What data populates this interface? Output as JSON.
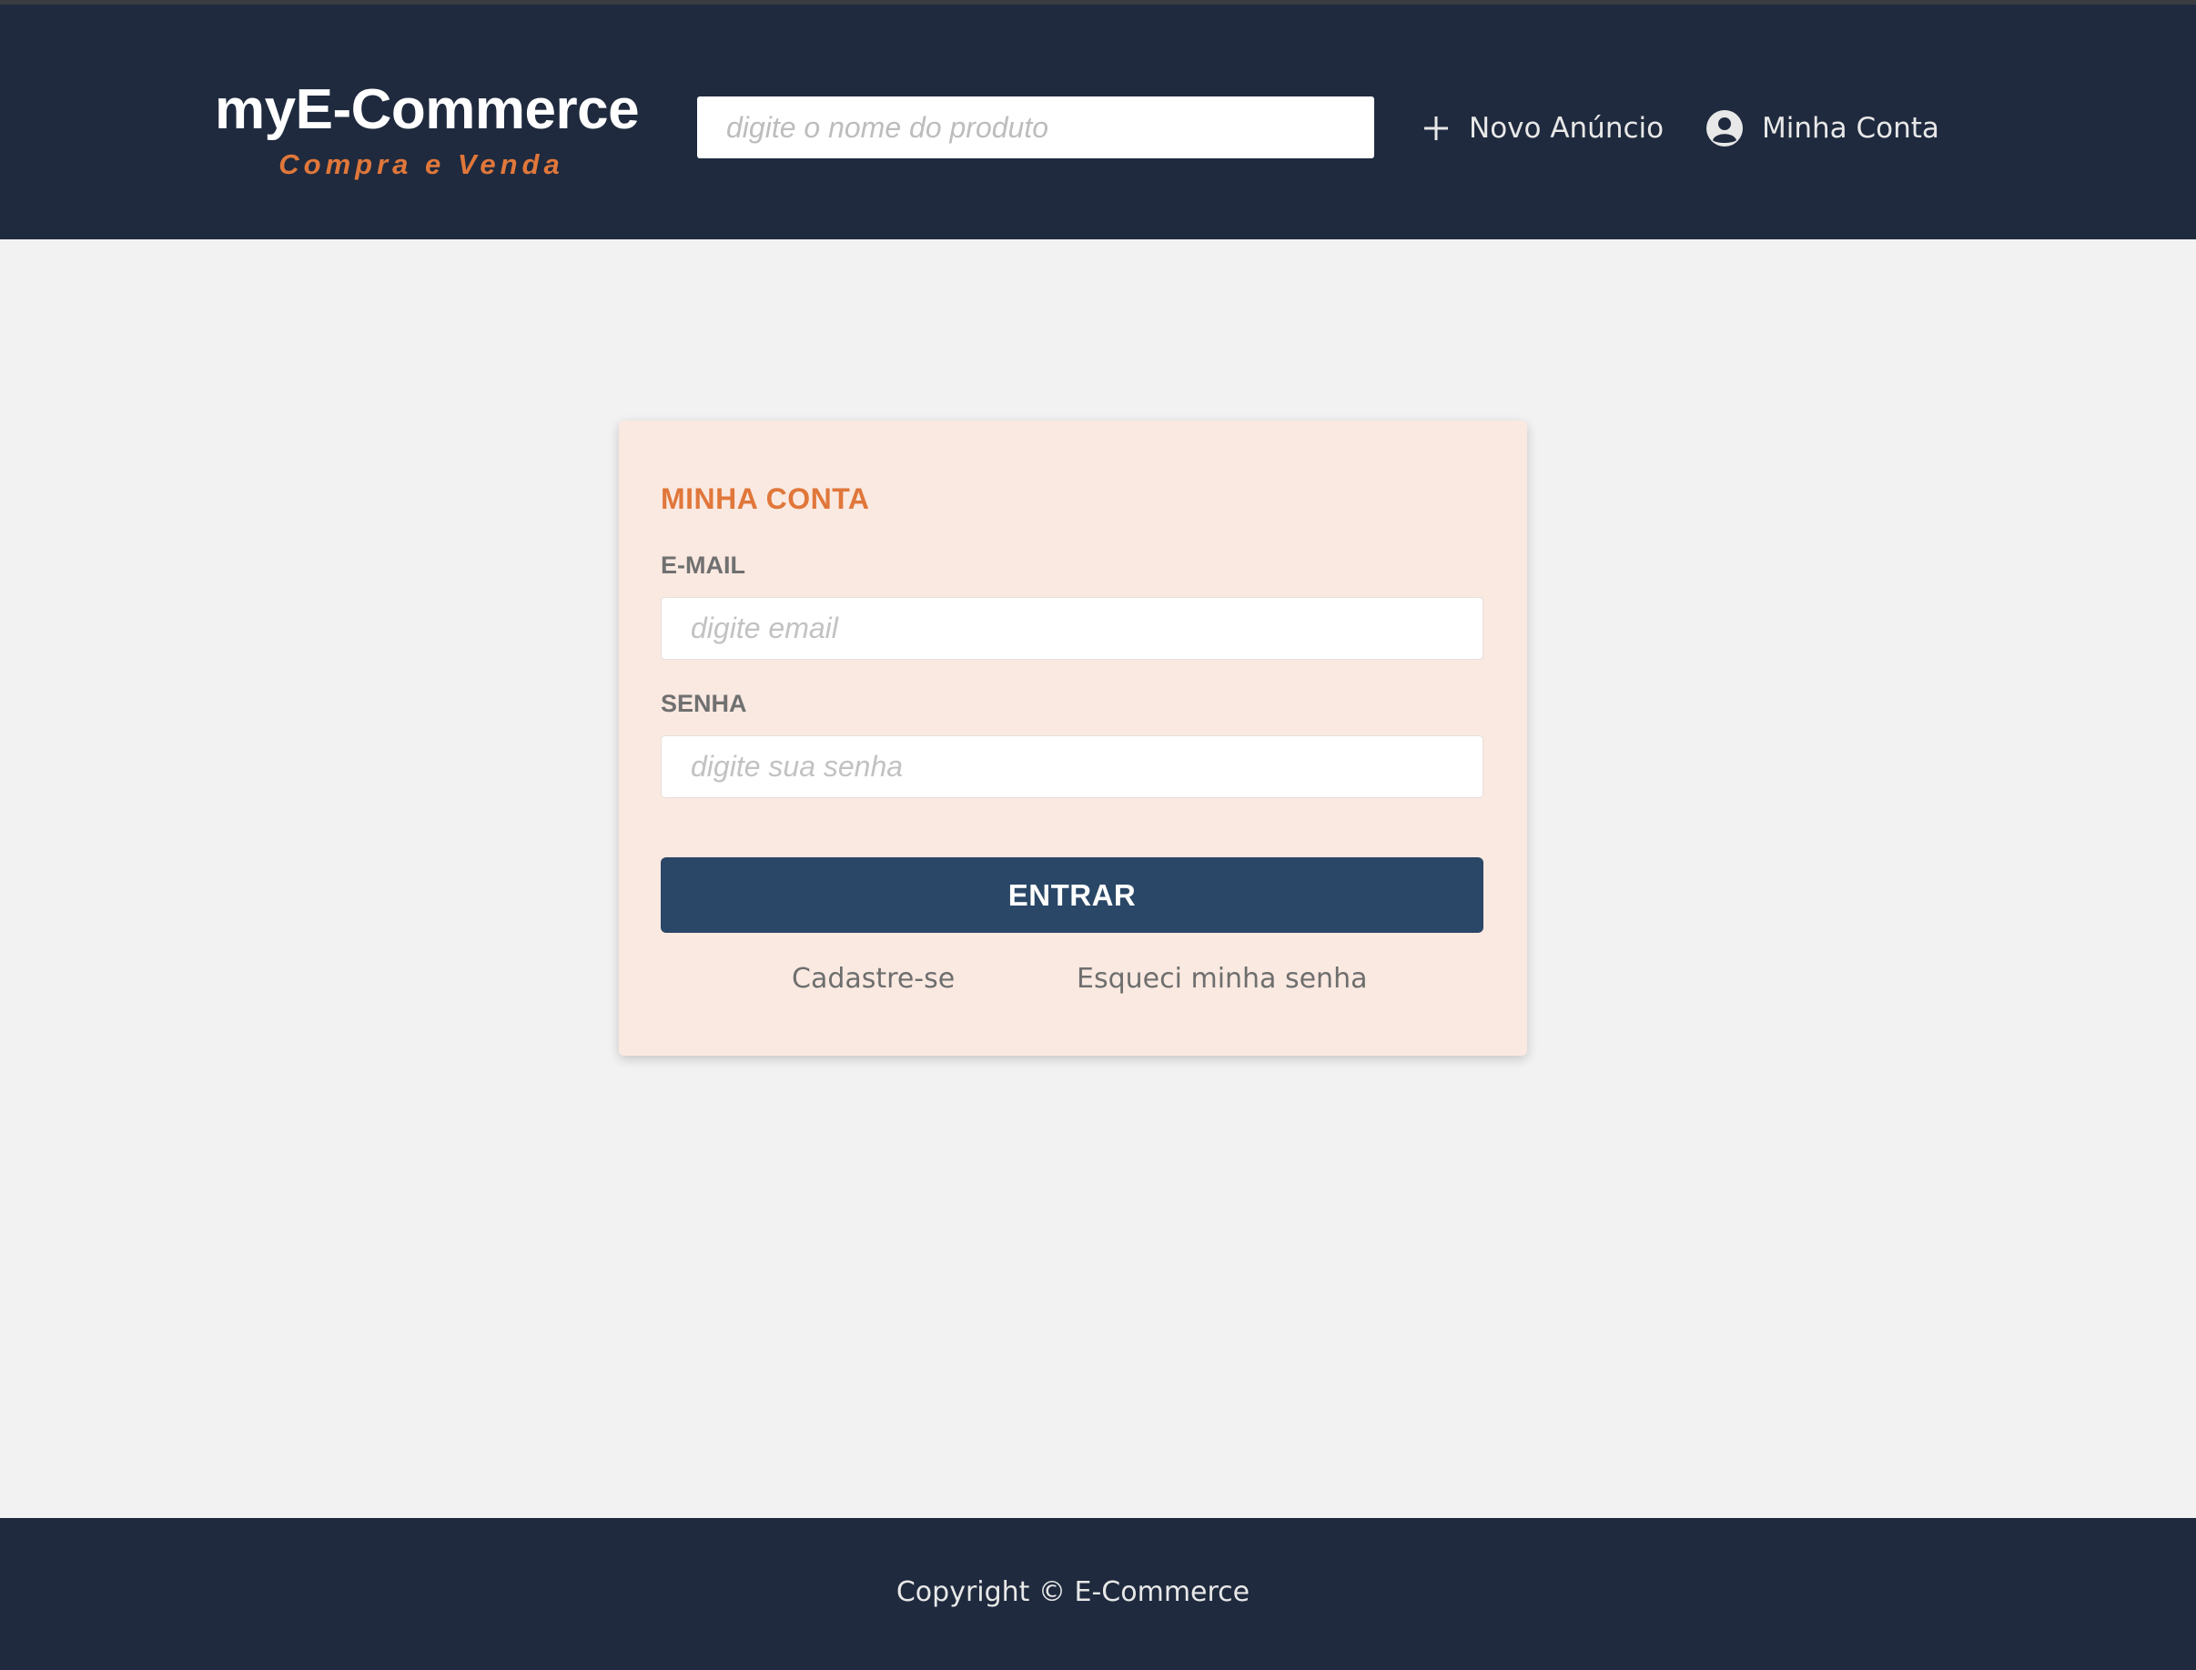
{
  "header": {
    "brand_title": "myE-Commerce",
    "brand_subtitle": "Compra e Venda",
    "search_placeholder": "digite o nome do produto",
    "nav": {
      "new_listing_label": "Novo Anúncio",
      "new_listing_icon": "plus-icon",
      "account_label": "Minha Conta",
      "account_icon": "user-circle-icon"
    }
  },
  "login": {
    "title": "MINHA CONTA",
    "email_label": "E-MAIL",
    "email_placeholder": "digite email",
    "password_label": "SENHA",
    "password_placeholder": "digite sua senha",
    "submit_label": "ENTRAR",
    "signup_link": "Cadastre-se",
    "forgot_link": "Esqueci minha senha"
  },
  "footer": {
    "copyright": "Copyright © E-Commerce"
  },
  "colors": {
    "header_bg": "#1f2a3e",
    "accent": "#e0773a",
    "card_bg": "#fae9e1",
    "button_bg": "#2b4767",
    "page_bg": "#f2f2f2"
  }
}
